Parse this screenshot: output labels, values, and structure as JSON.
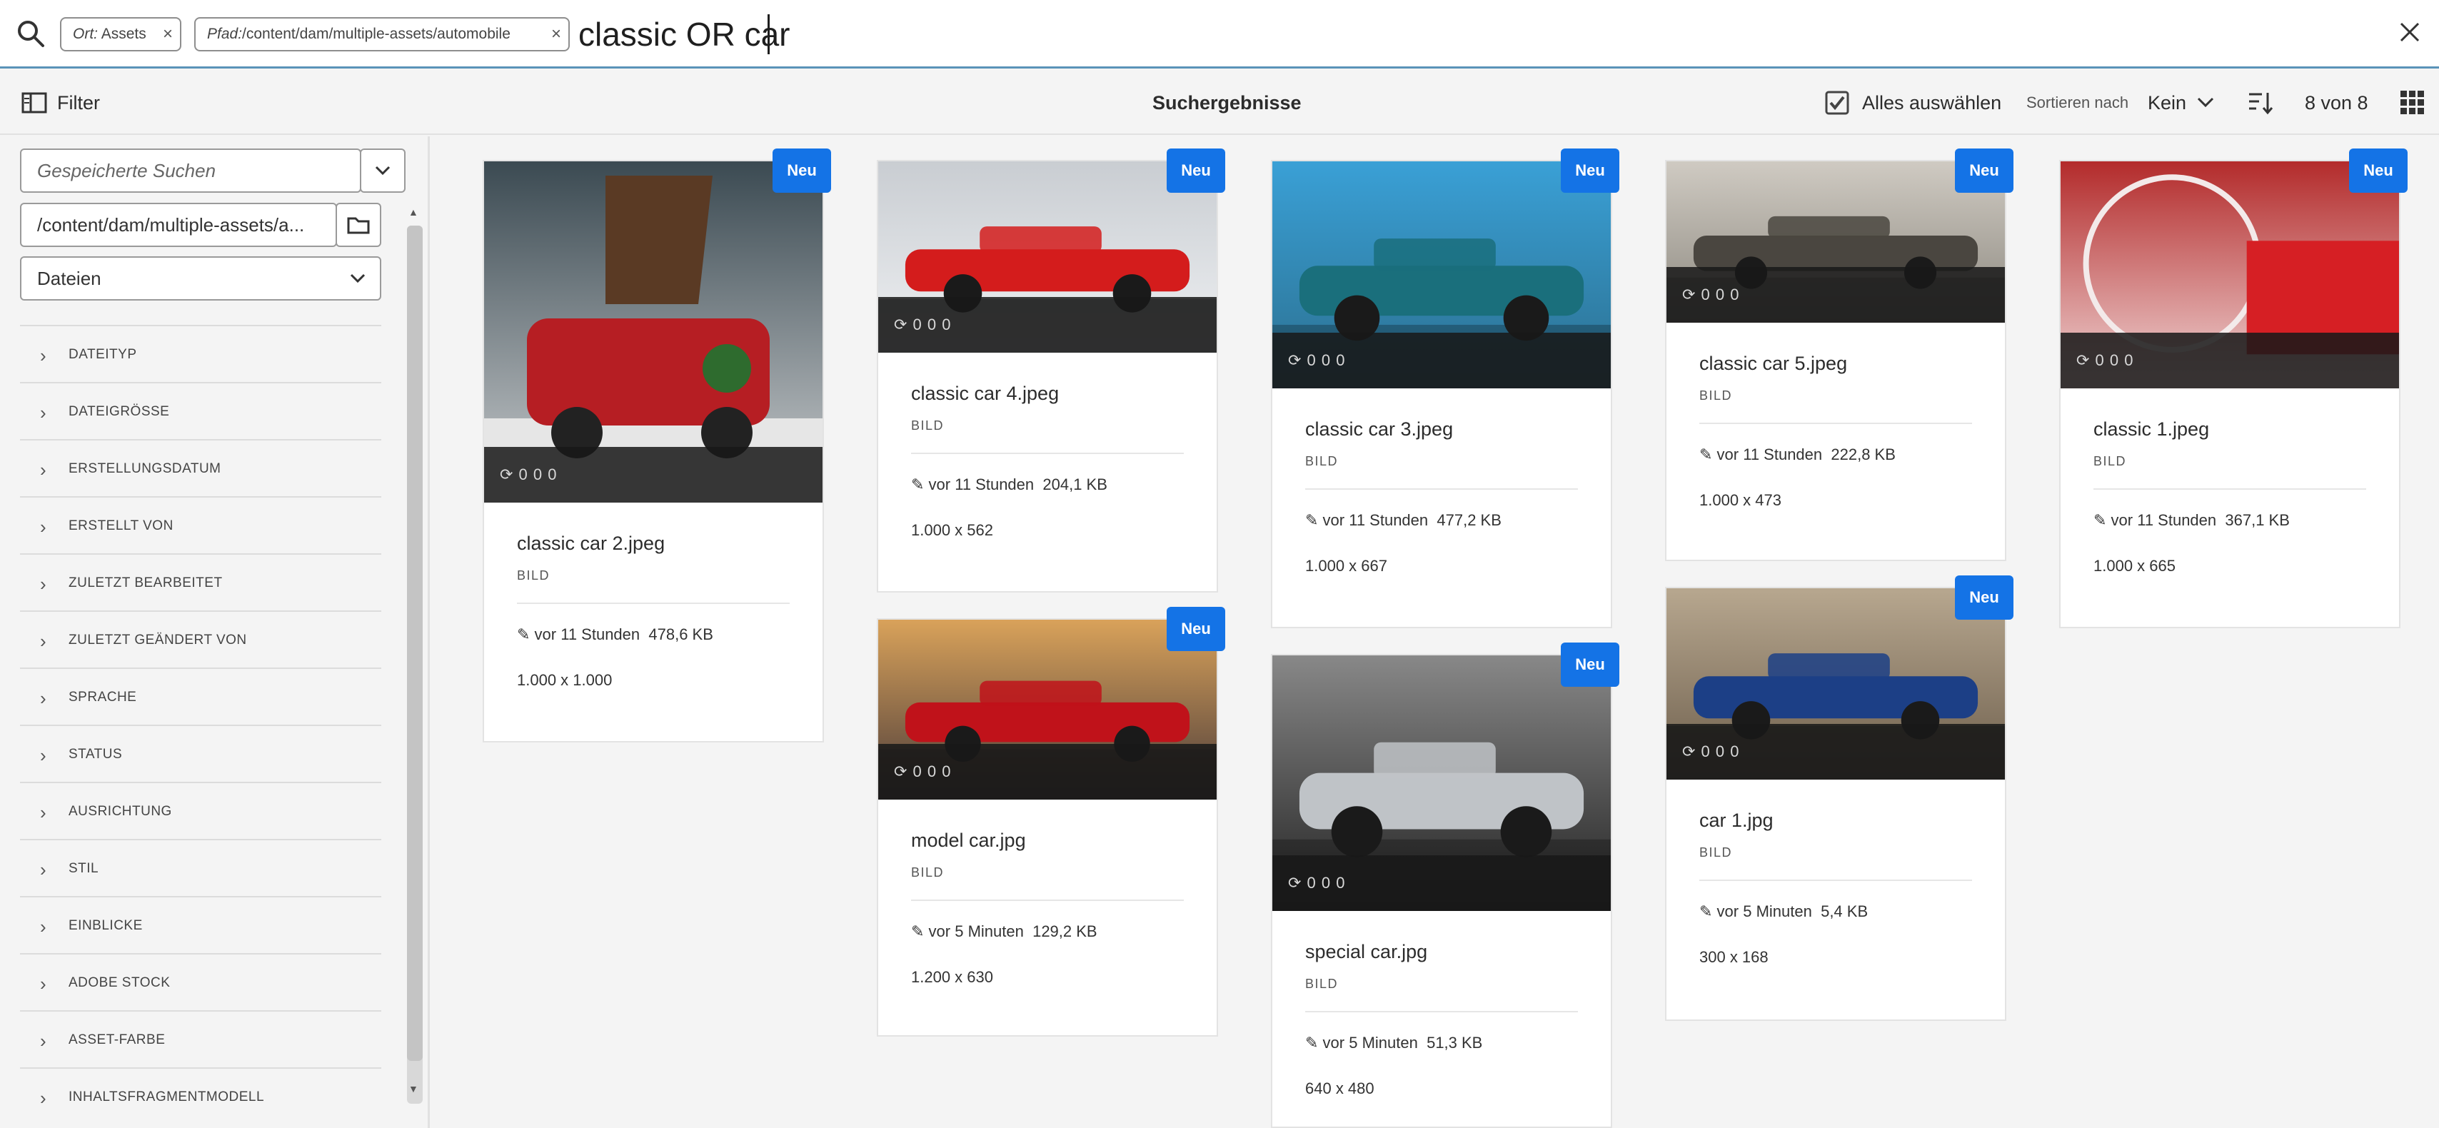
{
  "search": {
    "chips": [
      {
        "label": "Ort:",
        "value": "Assets"
      },
      {
        "label": "Pfad:",
        "value": "/content/dam/multiple-assets/automobile"
      }
    ],
    "query": "classic OR car"
  },
  "toolbar": {
    "filter_label": "Filter",
    "title": "Suchergebnisse",
    "select_all": "Alles auswählen",
    "sort_label": "Sortieren nach",
    "sort_value": "Kein",
    "count": "8 von 8"
  },
  "rail": {
    "saved_search_placeholder": "Gespeicherte Suchen",
    "path_value": "/content/dam/multiple-assets/a...",
    "type_value": "Dateien",
    "facets": [
      "DATEITYP",
      "DATEIGRÖSSE",
      "ERSTELLUNGSDATUM",
      "ERSTELLT VON",
      "ZULETZT BEARBEITET",
      "ZULETZT GEÄNDERT VON",
      "SPRACHE",
      "STATUS",
      "AUSRICHTUNG",
      "STIL",
      "EINBLICKE",
      "ADOBE STOCK",
      "ASSET-FARBE",
      "INHALTSFRAGMENTMODELL"
    ]
  },
  "badge_label": "Neu",
  "band_text": "0    0    0",
  "cards": [
    {
      "name": "classic car 2.jpeg",
      "type": "BILD",
      "modified": "vor 11 Stunden",
      "size": "478,6 KB",
      "dimensions": "1.000 x 1.000"
    },
    {
      "name": "classic car 4.jpeg",
      "type": "BILD",
      "modified": "vor 11 Stunden",
      "size": "204,1 KB",
      "dimensions": "1.000 x 562"
    },
    {
      "name": "model car.jpg",
      "type": "BILD",
      "modified": "vor 5 Minuten",
      "size": "129,2 KB",
      "dimensions": "1.200 x 630"
    },
    {
      "name": "classic car 3.jpeg",
      "type": "BILD",
      "modified": "vor 11 Stunden",
      "size": "477,2 KB",
      "dimensions": "1.000 x 667"
    },
    {
      "name": "special car.jpg",
      "type": "BILD",
      "modified": "vor 5 Minuten",
      "size": "51,3 KB",
      "dimensions": "640 x 480"
    },
    {
      "name": "classic car 5.jpeg",
      "type": "BILD",
      "modified": "vor 11 Stunden",
      "size": "222,8 KB",
      "dimensions": "1.000 x 473"
    },
    {
      "name": "car 1.jpg",
      "type": "BILD",
      "modified": "vor 5 Minuten",
      "size": "5,4 KB",
      "dimensions": "300 x 168"
    },
    {
      "name": "classic 1.jpeg",
      "type": "BILD",
      "modified": "vor 11 Stunden",
      "size": "367,1 KB",
      "dimensions": "1.000 x 665"
    }
  ]
}
